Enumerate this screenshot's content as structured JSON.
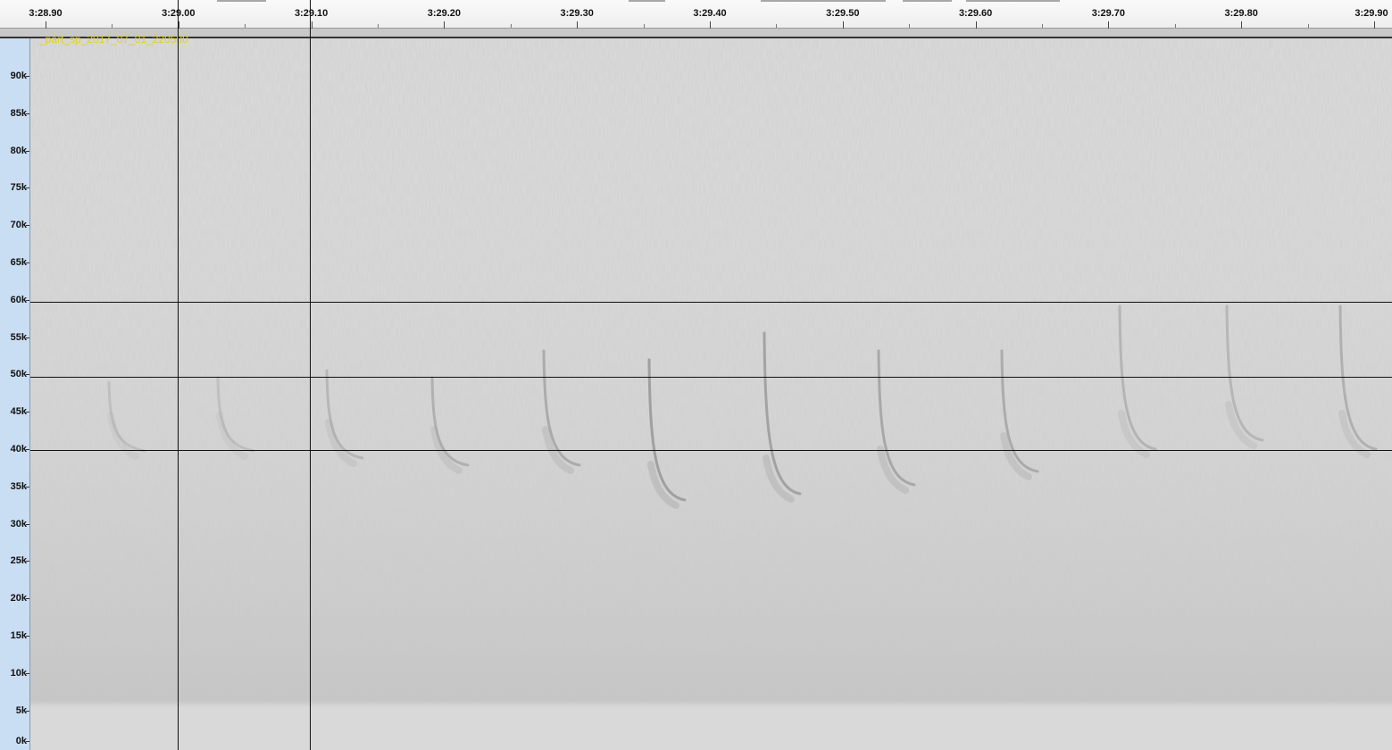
{
  "timeline": {
    "labels": [
      "3:28.90",
      "3:29.00",
      "3:29.10",
      "3:29.20",
      "3:29.30",
      "3:29.40",
      "3:29.50",
      "3:29.60",
      "3:29.70",
      "3:29.80",
      "3:29.90"
    ]
  },
  "track": {
    "name": "_part_sp_2017_07_01_220500"
  },
  "frequency_scale": {
    "labels": [
      "90k",
      "85k",
      "80k",
      "75k",
      "70k",
      "65k",
      "60k",
      "55k",
      "50k",
      "45k",
      "40k",
      "35k",
      "30k",
      "25k",
      "20k",
      "15k",
      "10k",
      "5k",
      "0k"
    ]
  },
  "colors": {
    "background": "#d6d6d6",
    "scale_panel": "#c9ddf3",
    "track_name": "#e0d21a"
  }
}
